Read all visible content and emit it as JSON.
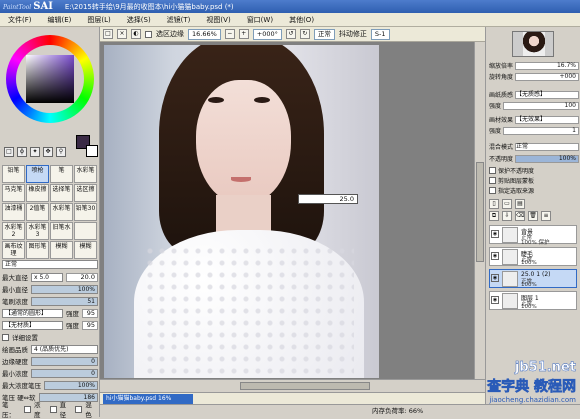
{
  "app": {
    "logo_small": "PaintTool",
    "logo_big": "SAI",
    "title": "E:\\2015转手绘\\9月最的收图本\\hi小猫猫baby.psd (*)"
  },
  "menu": [
    "文件(F)",
    "编辑(E)",
    "图层(L)",
    "选择(S)",
    "滤镜(T)",
    "视图(V)",
    "窗口(W)",
    "其他(O)"
  ],
  "toolbar": {
    "selection_edge_label": "选区边缘",
    "zoom": "16.66%",
    "rotation": "+000°",
    "blend": "正常",
    "stabilizer_label": "抖动修正",
    "stabilizer": "S-1"
  },
  "left": {
    "brushes": [
      "铅笔",
      "喷枪",
      "笔",
      "水彩笔",
      "马克笔",
      "橡皮擦",
      "选择笔",
      "选区擦",
      "油漆桶",
      "2值笔",
      "水彩笔",
      "铅笔30",
      "水彩笔2",
      "水彩笔3",
      "旧笔水",
      "",
      "画布纹理",
      "图形笔",
      "模糊",
      "模糊"
    ],
    "mode": "正常",
    "max_diameter_label": "最大直径",
    "max_diameter": "x 5.0",
    "diameter_value": "20.0",
    "min_diameter_label": "最小直径",
    "min_diameter": "100%",
    "density_label": "笔刷浓度",
    "density": "51",
    "shape": "【通常的圆形】",
    "shape_strength_label": "强度",
    "shape_strength": "95",
    "texture": "【无材质】",
    "texture_strength_label": "强度",
    "texture_strength": "95",
    "detail_label": "详细设置",
    "quality_label": "绘画品质",
    "quality": "4 (品质优先)",
    "edge_hardness_label": "边缘硬度",
    "edge_hardness": "0",
    "min_density_label": "最小浓度",
    "min_density": "0",
    "max_pressure_label": "最大浓度笔压",
    "max_pressure": "100%",
    "pressure_soft_label": "笔压 硬⇔软",
    "pressure_soft": "186",
    "pressure_opts": [
      "笔压：",
      "浓度",
      "直径",
      "混色"
    ]
  },
  "canvas": {
    "popup_value": "25.0",
    "tab": "hi小猫猫baby.psd",
    "tab_pct": "16%"
  },
  "status": {
    "mem": "内存负荷率: 66%"
  },
  "right": {
    "zoom_label": "缩放倍率",
    "zoom": "16.7%",
    "angle_label": "旋转角度",
    "angle": "+000",
    "paper_label": "画纸质感",
    "paper": "【无质感】",
    "paper_strength_label": "强度",
    "paper_strength": "100",
    "effect_label": "画材效果",
    "effect": "【无效果】",
    "effect_strength_label": "强度",
    "effect_strength": "1",
    "blend_label": "混合模式",
    "blend": "正常",
    "opacity_label": "不透明度",
    "opacity": "100%",
    "checks": [
      "保护不透明度",
      "剪贴图层蒙板",
      "指定选取来源"
    ],
    "layers": [
      {
        "name": "背景",
        "mode": "正常",
        "pct": "100%",
        "selected": false
      },
      {
        "name": "睫毛",
        "mode": "正常",
        "pct": "100%",
        "selected": false
      },
      {
        "name": "25.0  1 (2)",
        "mode": "正常",
        "pct": "100%",
        "selected": true
      },
      {
        "name": "图层 1",
        "mode": "正常",
        "pct": "100%",
        "selected": false
      }
    ],
    "layer_extra": "100% 保护"
  },
  "watermark": {
    "line1": "jb51.net",
    "line2": "查字典 教程网",
    "line3": "jiaocheng.chazidian.com"
  }
}
